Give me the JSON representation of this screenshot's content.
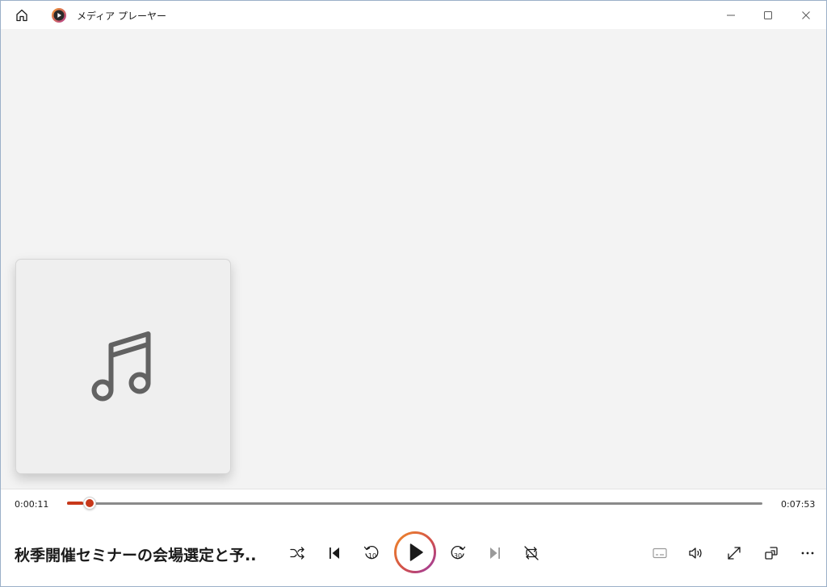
{
  "app": {
    "title": "メディア プレーヤー"
  },
  "player": {
    "current_time": "0:00:11",
    "total_time": "0:07:53",
    "progress_fraction": 0.0233,
    "track_title": "秋季開催セミナーの会場選定と予..."
  },
  "colors": {
    "accent": "#c8381a",
    "play_ring_start": "#e8822a",
    "play_ring_end": "#a23a9c",
    "content_bg": "#f3f3f3"
  },
  "icons": {
    "home": "home-icon",
    "logo": "media-player-logo",
    "music": "music-note-icon",
    "shuffle": "shuffle-icon",
    "previous": "previous-icon",
    "rewind": "rewind-10-icon",
    "play": "play-icon",
    "forward": "forward-30-icon",
    "next": "next-icon",
    "repeat": "repeat-icon",
    "subtitles": "subtitles-icon",
    "volume": "volume-icon",
    "fullscreen": "fullscreen-icon",
    "miniplayer": "miniplayer-icon",
    "more": "more-icon"
  },
  "controls": {
    "rewind_label": "10",
    "forward_label": "30"
  }
}
